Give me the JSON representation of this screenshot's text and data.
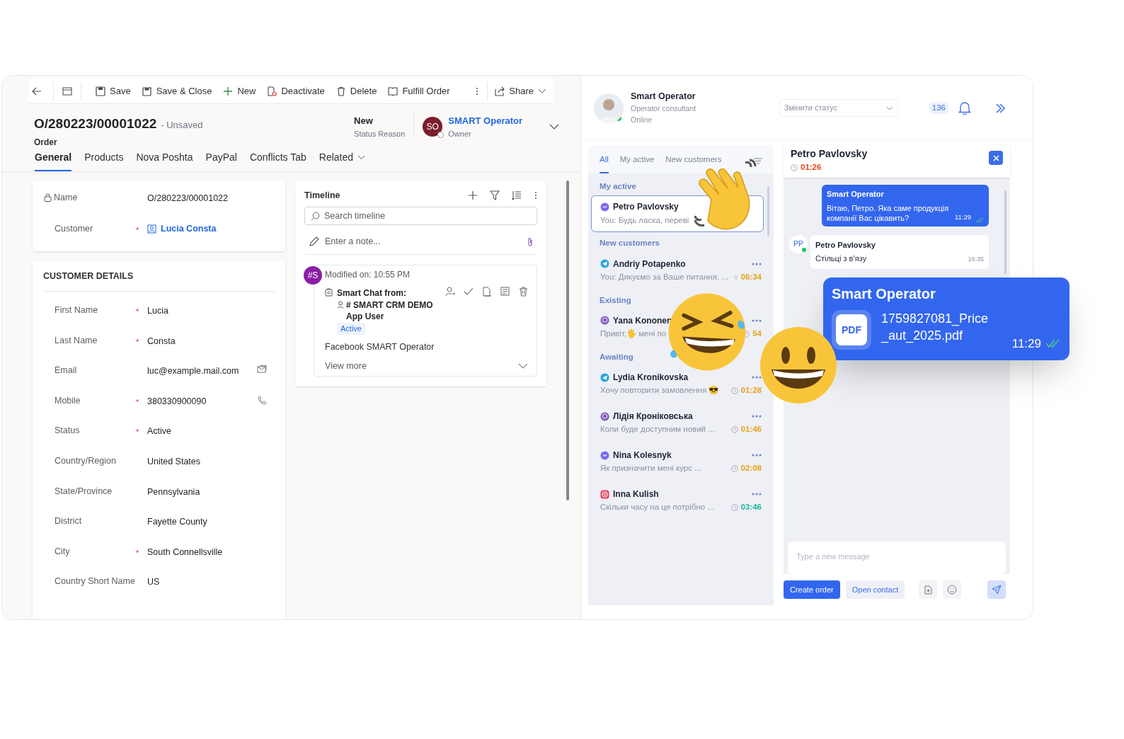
{
  "toolbar": {
    "buttons": [
      "Save",
      "Save & Close",
      "New",
      "Deactivate",
      "Delete",
      "Fulfill Order"
    ],
    "share": "Share"
  },
  "record": {
    "title": "O/280223/00001022",
    "state": "- Unsaved",
    "entity": "Order",
    "status_value": "New",
    "status_label": "Status Reason",
    "owner_initials": "SO",
    "owner_name": "SMART Operator",
    "owner_label": "Owner"
  },
  "tabs": [
    {
      "label": "General",
      "selected": true
    },
    {
      "label": "Products",
      "selected": false
    },
    {
      "label": "Nova Poshta",
      "selected": false
    },
    {
      "label": "PayPal",
      "selected": false
    },
    {
      "label": "Conflicts Tab",
      "selected": false
    },
    {
      "label": "Related",
      "selected": false
    }
  ],
  "summary_fields": [
    {
      "label": "Name",
      "value": "O/280223/00001022",
      "locked": true,
      "kind": "text"
    },
    {
      "label": "Customer",
      "value": "Lucia Consta",
      "required_mark": "*",
      "locked": false,
      "kind": "lookup"
    }
  ],
  "customer_details": {
    "title": "CUSTOMER DETAILS",
    "fields": [
      {
        "label": "First Name",
        "value": "Lucia",
        "required_mark": "*",
        "kind": "text"
      },
      {
        "label": "Last Name",
        "value": "Consta",
        "required_mark": "*",
        "kind": "text"
      },
      {
        "label": "Email",
        "value": "luc@example.mail.com",
        "kind": "email"
      },
      {
        "label": "Mobile",
        "value": "380330900090",
        "required_mark": "*",
        "kind": "phone"
      },
      {
        "label": "Status",
        "value": "Active",
        "required_mark": "*",
        "kind": "text"
      },
      {
        "label": "Country/Region",
        "value": "United States",
        "kind": "text"
      },
      {
        "label": "State/Province",
        "value": "Pennsylvania",
        "kind": "text"
      },
      {
        "label": "District",
        "value": "Fayette County",
        "kind": "text"
      },
      {
        "label": "City",
        "value": "South Connellsville",
        "required_mark": "*",
        "kind": "text"
      },
      {
        "label": "Country Short Name",
        "value": "US",
        "kind": "text"
      }
    ]
  },
  "timeline": {
    "title": "Timeline",
    "search_placeholder": "Search timeline",
    "note_placeholder": "Enter a note...",
    "entry": {
      "avatar": "#S",
      "modified": "Modified on: 10:55 PM",
      "subject": "Smart Chat from:",
      "user": "# SMART CRM DEMO App User",
      "status": "Active",
      "description": "Facebook SMART Operator",
      "more": "View more"
    }
  },
  "operator": {
    "name": "Smart Operator",
    "role": "Operator consultant",
    "presence": "Online",
    "status_placeholder": "Змінити статус",
    "notifications": "136"
  },
  "chat_tabs": [
    {
      "label": "All",
      "selected": true
    },
    {
      "label": "My active",
      "selected": false
    },
    {
      "label": "New customers",
      "selected": false
    }
  ],
  "chat_groups": [
    {
      "title": "My active",
      "chats": [
        {
          "kind": "messenger",
          "name": "Petro Pavlovsky",
          "preview": "You: Будь ласка, переві",
          "selected": true
        }
      ]
    },
    {
      "title": "New customers",
      "chats": [
        {
          "kind": "telegram",
          "name": "Andriy Potapenko",
          "preview": "You: Дякуємо за Ваше питання, ...",
          "time": "06:34",
          "color": "#e8a21a",
          "selected": false
        }
      ]
    },
    {
      "title": "Existing",
      "chats": [
        {
          "kind": "viber",
          "name": "Yana Kononen",
          "preview": "Привіт,🖐 мені по",
          "time": "54",
          "color": "#e8a21a",
          "selected": false
        }
      ]
    },
    {
      "title": "Awaiting",
      "chats": [
        {
          "kind": "telegram",
          "name": "Lydia Kronikovska",
          "preview": "Хочу повторити замовлення 😎",
          "time": "01:28",
          "color": "#e8a21a",
          "selected": false
        },
        {
          "kind": "viber",
          "name": "Лідія Кроніковська",
          "preview": "Коли буде доступним новий ...",
          "time": "01:46",
          "color": "#e8a21a",
          "selected": false
        },
        {
          "kind": "messenger",
          "name": "Nina Kolesnyk",
          "preview": "Як призначити мені курс ...",
          "time": "02:08",
          "color": "#e8a21a",
          "selected": false
        },
        {
          "kind": "instagram",
          "name": "Inna Kulish",
          "preview": "Скільки часу на це потрібно ...",
          "time": "03:46",
          "color": "#1fb5a0",
          "selected": false
        }
      ]
    }
  ],
  "conversation": {
    "name": "Petro Pavlovsky",
    "timer": "01:26",
    "messages": [
      {
        "kind": "outgoing",
        "author": "Smart Operator",
        "text": "Вітаю, Петро. Яка саме продукція компанії Вас цікавить?",
        "time": "11:29",
        "read": true
      },
      {
        "kind": "incoming",
        "initials": "PP",
        "author": "Petro Pavlovsky",
        "text": "Стільці з в’язу",
        "time": "16:35"
      }
    ],
    "composer_placeholder": "Type a new message",
    "actions": [
      "Create order",
      "Open contact"
    ]
  },
  "attachment_popup": {
    "author": "Smart Operator",
    "file_type": "PDF",
    "file_name": "1759827081_Price_aut_2025.pdf",
    "time": "11:29",
    "read": true
  }
}
